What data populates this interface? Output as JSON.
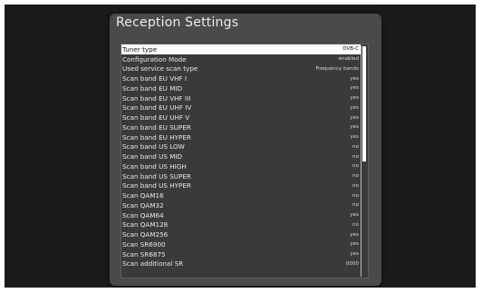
{
  "dialog": {
    "title": "Reception Settings"
  },
  "settings": [
    {
      "label": "Tuner type",
      "value": "DVB-C",
      "selected": true
    },
    {
      "label": "Configuration Mode",
      "value": "enabled"
    },
    {
      "label": "Used service scan type",
      "value": "Frequency bands"
    },
    {
      "label": "Scan band EU VHF I",
      "value": "yes"
    },
    {
      "label": "Scan band EU MID",
      "value": "yes"
    },
    {
      "label": "Scan band EU VHF III",
      "value": "yes"
    },
    {
      "label": "Scan band EU UHF IV",
      "value": "yes"
    },
    {
      "label": "Scan band EU UHF V",
      "value": "yes"
    },
    {
      "label": "Scan band EU SUPER",
      "value": "yes"
    },
    {
      "label": "Scan band EU HYPER",
      "value": "yes"
    },
    {
      "label": "Scan band US LOW",
      "value": "no"
    },
    {
      "label": "Scan band US MID",
      "value": "no"
    },
    {
      "label": "Scan band US HIGH",
      "value": "no"
    },
    {
      "label": "Scan band US SUPER",
      "value": "no"
    },
    {
      "label": "Scan band US HYPER",
      "value": "no"
    },
    {
      "label": "Scan QAM16",
      "value": "no"
    },
    {
      "label": "Scan QAM32",
      "value": "no"
    },
    {
      "label": "Scan QAM64",
      "value": "yes"
    },
    {
      "label": "Scan QAM128",
      "value": "no"
    },
    {
      "label": "Scan QAM256",
      "value": "yes"
    },
    {
      "label": "Scan SR6900",
      "value": "yes"
    },
    {
      "label": "Scan SR6875",
      "value": "yes"
    },
    {
      "label": "Scan additional SR",
      "value": "0000"
    }
  ],
  "scrollbar": {
    "visible_fraction": 0.5
  },
  "colors": {
    "screen_background": "#1b1b1b",
    "dialog_background": "#4a4a4a",
    "selection_highlight": "#ffffff",
    "text": "#e8e8e8"
  }
}
